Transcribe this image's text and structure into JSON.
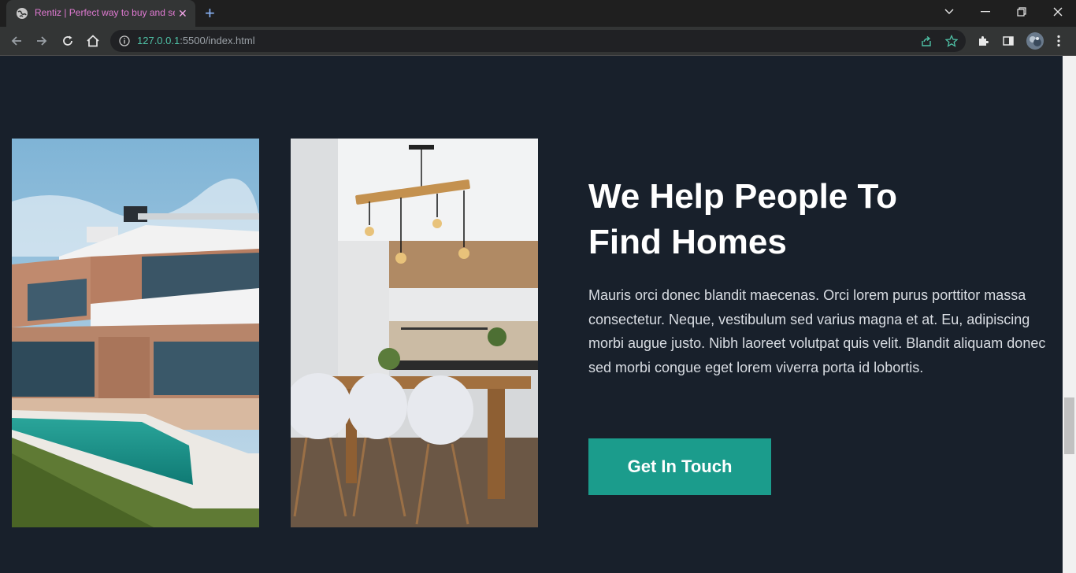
{
  "browser": {
    "tab_title": "Rentiz | Perfect way to buy and se",
    "url_host": "127.0.0.1",
    "url_rest": ":5500/index.html"
  },
  "section": {
    "headline_line1": "We Help People To",
    "headline_line2": "Find Homes",
    "body": "Mauris orci donec blandit maecenas. Orci lorem purus porttitor massa consectetur. Neque, vestibulum sed varius magna et at. Eu, adipiscing morbi augue justo. Nibh laoreet volutpat quis velit. Blandit aliquam donec sed morbi congue eget lorem viverra porta id lobortis.",
    "cta_label": "Get In Touch"
  },
  "colors": {
    "page_bg": "#18202b",
    "accent": "#1b9c8c"
  }
}
